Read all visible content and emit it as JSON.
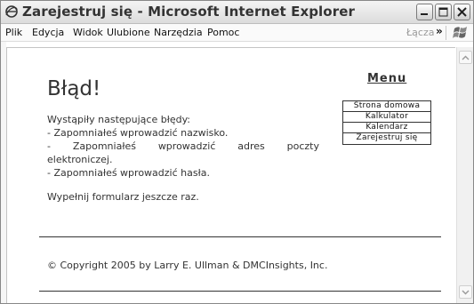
{
  "window": {
    "title": "Zarejestruj się - Microsoft Internet Explorer"
  },
  "menubar": {
    "items": [
      {
        "label": "Plik"
      },
      {
        "label": "Edycja"
      },
      {
        "label": "Widok"
      },
      {
        "label": "Ulubione"
      },
      {
        "label": "Narzędzia"
      },
      {
        "label": "Pomoc"
      }
    ],
    "links_label": "Łącza"
  },
  "page": {
    "title": "Błąd!",
    "intro": "Wystąpiły następujące błędy:",
    "errors": [
      "- Zapomniałeś wprowadzić nazwisko.",
      "-",
      "Zapomniałeś",
      "wprowadzić",
      "adres",
      "poczty",
      "elektroniczej.",
      "- Zapomniałeś wprowadzić hasła."
    ],
    "retry": "Wypełnij formularz jeszcze raz.",
    "footer": "© Copyright 2005 by Larry E. Ullman & DMCInsights, Inc."
  },
  "nav": {
    "heading": "Menu",
    "items": [
      {
        "label": "Strona domowa"
      },
      {
        "label": "Kalkulator"
      },
      {
        "label": "Kalendarz"
      },
      {
        "label": "Zarejestruj się"
      }
    ]
  }
}
